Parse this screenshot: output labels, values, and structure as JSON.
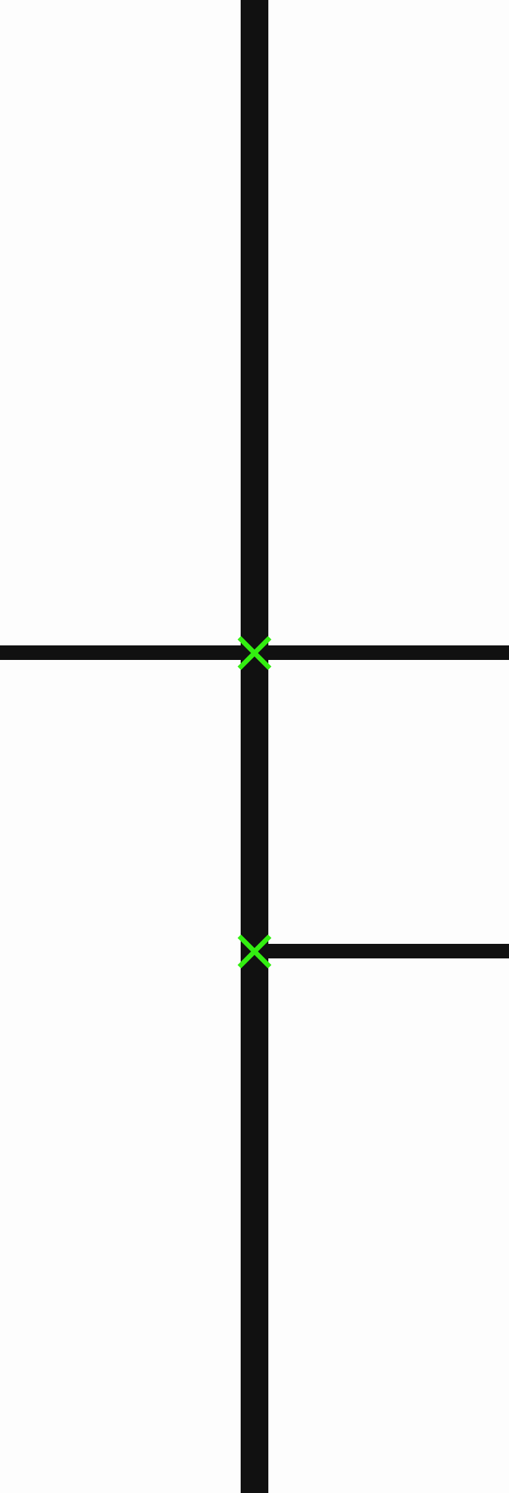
{
  "colors": {
    "background": "#fdfdfd",
    "line": "#111111",
    "marker": "#33ee11"
  },
  "diagram": {
    "edges": [
      {
        "name": "vertical-trunk-line",
        "from": "top-end",
        "to": "bottom-end",
        "weight": "thick"
      },
      {
        "name": "upper-crossing-line",
        "from": "left-end",
        "to": "right-end-upper",
        "weight": "thin"
      },
      {
        "name": "lower-branch-line",
        "from": "junction-lower",
        "to": "right-end-lower",
        "weight": "thin"
      }
    ],
    "markers": [
      {
        "name": "junction-marker-upper",
        "icon": "x-mark-icon",
        "at": "junction-upper"
      },
      {
        "name": "junction-marker-lower",
        "icon": "x-mark-icon",
        "at": "junction-lower"
      }
    ]
  }
}
